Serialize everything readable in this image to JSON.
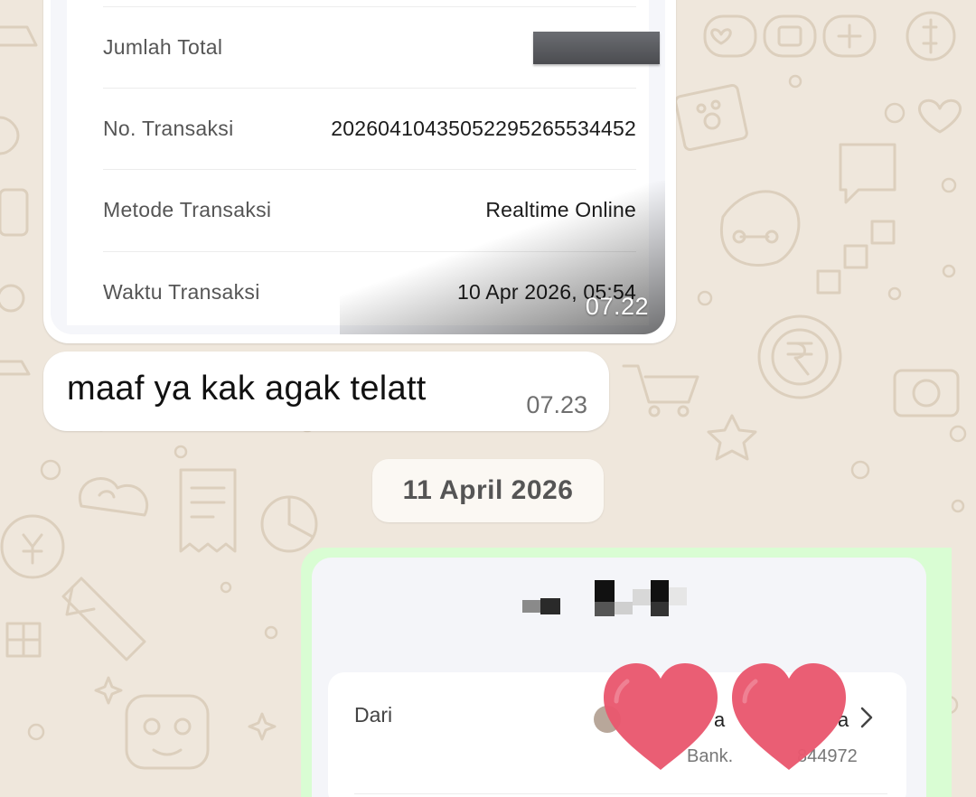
{
  "chat": {
    "receipt_message": {
      "rows": [
        {
          "label": "Jumlah Total",
          "value": ""
        },
        {
          "label": "No. Transaksi",
          "value": "20260410435052295265534452"
        },
        {
          "label": "Metode Transaksi",
          "value": "Realtime Online"
        },
        {
          "label": "Waktu Transaksi",
          "value": "10 Apr 2026, 05:54"
        }
      ],
      "time": "07.22"
    },
    "text_message": {
      "text": "maaf ya kak agak telatt",
      "time": "07.23"
    },
    "date_divider": "11 April 2026",
    "outgoing_receipt": {
      "from_label": "Dari",
      "name_fragment_a": "a",
      "name_fragment_b": "a",
      "account_fragment_a": "Bank.",
      "account_fragment_b": "844972"
    }
  },
  "colors": {
    "wallpaper": "#efe7dc",
    "bubble_incoming": "#ffffff",
    "bubble_outgoing": "#d9fdd3",
    "heart": "#e9576e"
  },
  "icons": {
    "chevron": "chevron-right-icon",
    "heart": "heart-sticker-icon"
  }
}
